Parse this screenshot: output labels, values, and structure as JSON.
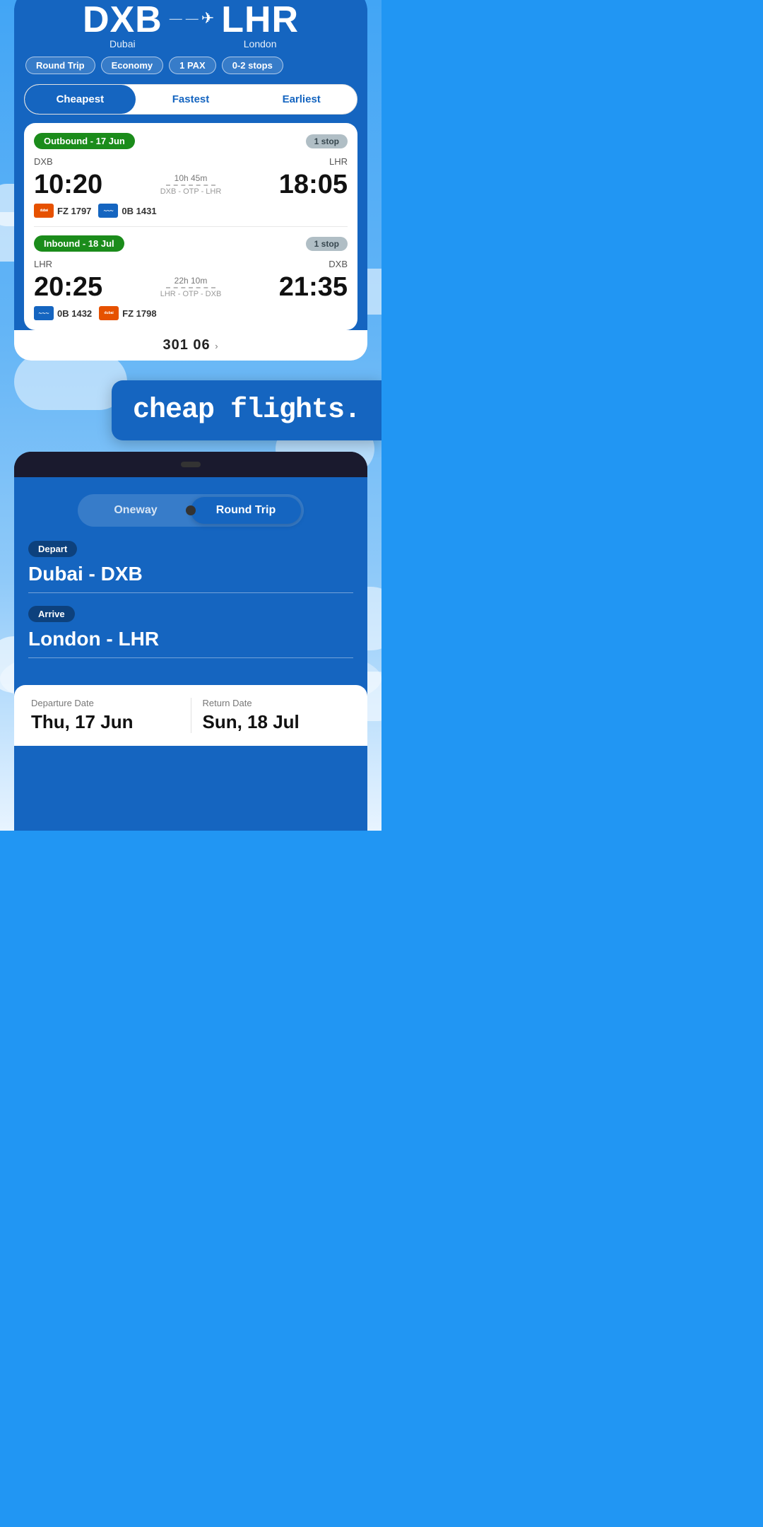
{
  "top_phone": {
    "origin_code": "DXB",
    "origin_name": "Dubai",
    "dest_code": "LHR",
    "dest_name": "London",
    "pills": {
      "trip_type": "Round Trip",
      "cabin": "Economy",
      "pax": "1 PAX",
      "stops": "0-2 stops"
    },
    "tabs": {
      "cheapest": "Cheapest",
      "fastest": "Fastest",
      "earliest": "Earliest",
      "active": "cheapest"
    },
    "outbound": {
      "label": "Outbound - 17 Jun",
      "stop_badge": "1 stop",
      "from": "DXB",
      "to": "LHR",
      "dep_time": "10:20",
      "arr_time": "18:05",
      "duration": "10h 45m",
      "route": "DXB - OTP - LHR",
      "flight1_code": "FZ 1797",
      "flight2_code": "0B 1431"
    },
    "inbound": {
      "label": "Inbound - 18 Jul",
      "stop_badge": "1 stop",
      "from": "LHR",
      "to": "DXB",
      "dep_time": "20:25",
      "arr_time": "21:35",
      "duration": "22h 10m",
      "route": "LHR - OTP - DXB",
      "flight1_code": "0B 1432",
      "flight2_code": "FZ 1798"
    }
  },
  "banner": {
    "text": "cheap flights."
  },
  "bottom_phone": {
    "trip_toggle": {
      "oneway": "Oneway",
      "round_trip": "Round Trip",
      "active": "round_trip"
    },
    "depart_label": "Depart",
    "depart_value": "Dubai - DXB",
    "arrive_label": "Arrive",
    "arrive_value": "London - LHR",
    "departure_date_label": "Departure Date",
    "departure_date_value": "Thu, 17 Jun",
    "return_date_label": "Return Date",
    "return_date_value": "Sun, 18 Jul"
  }
}
